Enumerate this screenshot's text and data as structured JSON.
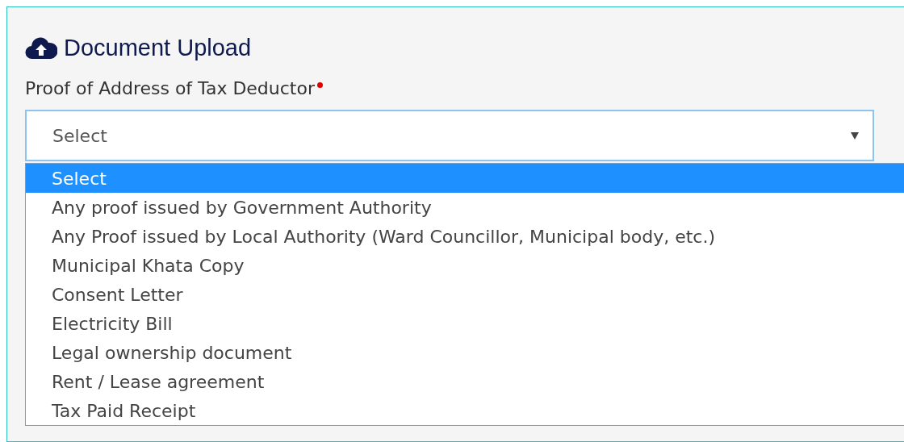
{
  "title": "Document Upload",
  "field": {
    "label": "Proof of Address of Tax Deductor",
    "required": true,
    "value": "Select"
  },
  "options": [
    {
      "label": "Select",
      "selected": true
    },
    {
      "label": "Any proof issued by Government Authority",
      "selected": false
    },
    {
      "label": "Any Proof issued by Local Authority (Ward Councillor, Municipal body, etc.)",
      "selected": false
    },
    {
      "label": "Municipal Khata Copy",
      "selected": false
    },
    {
      "label": "Consent Letter",
      "selected": false
    },
    {
      "label": "Electricity Bill",
      "selected": false
    },
    {
      "label": "Legal ownership document",
      "selected": false
    },
    {
      "label": "Rent / Lease agreement",
      "selected": false
    },
    {
      "label": "Tax Paid Receipt",
      "selected": false
    }
  ]
}
